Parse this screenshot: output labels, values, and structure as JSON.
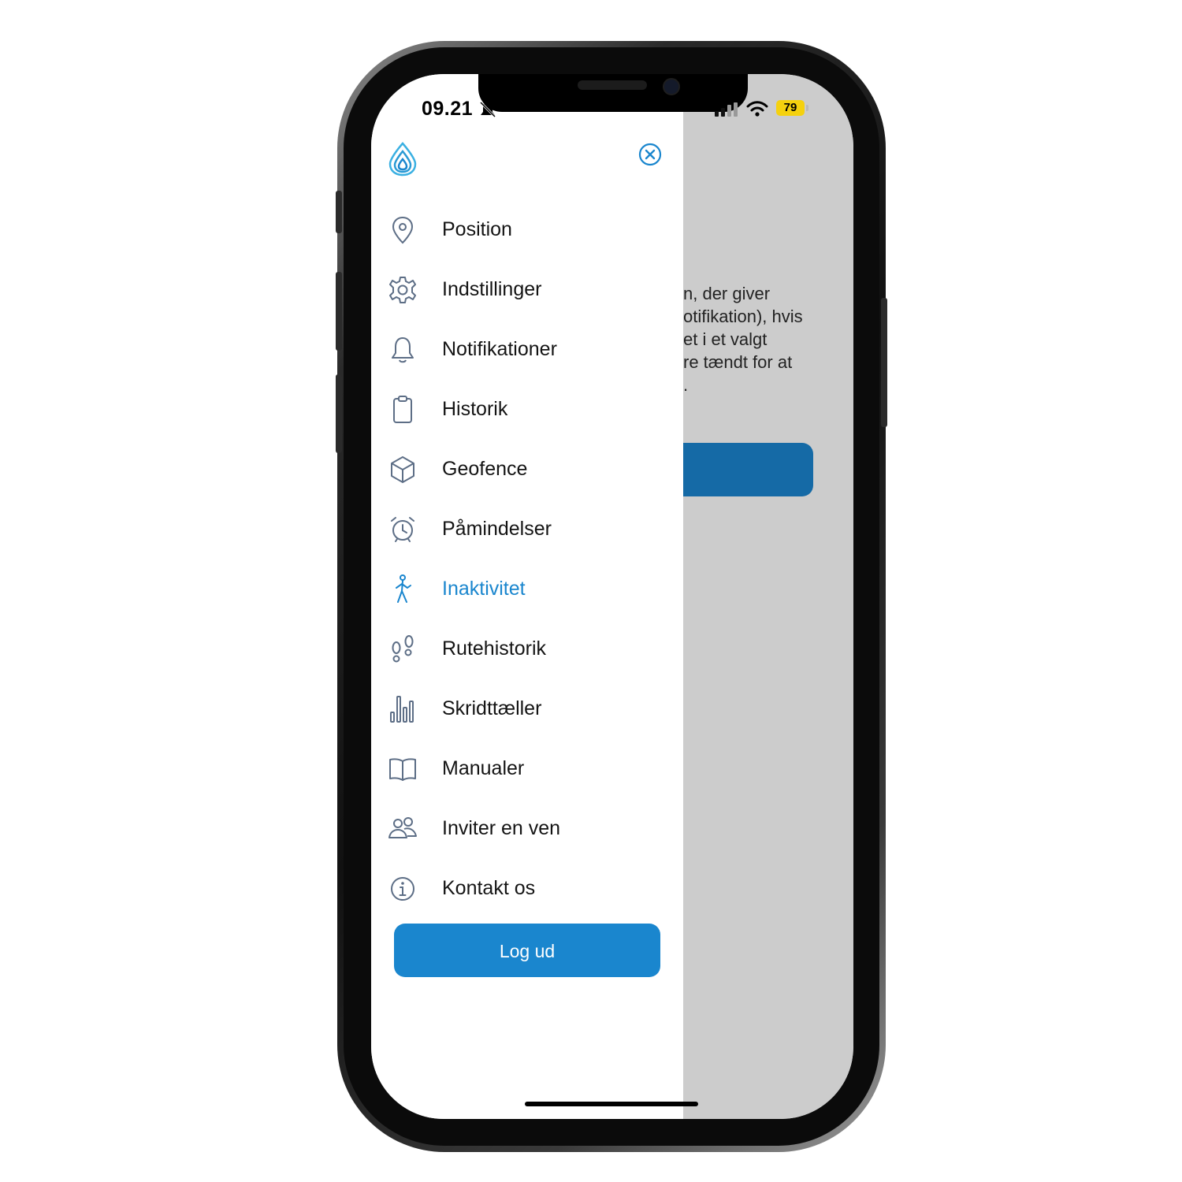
{
  "status_bar": {
    "time": "09.21",
    "battery": "79"
  },
  "background_text": [
    "n, der giver",
    "otifikation), hvis",
    "et i et valgt",
    "re tændt for at",
    "."
  ],
  "menu": {
    "items": [
      {
        "label": "Position",
        "icon": "location-pin-icon"
      },
      {
        "label": "Indstillinger",
        "icon": "gear-icon"
      },
      {
        "label": "Notifikationer",
        "icon": "bell-icon"
      },
      {
        "label": "Historik",
        "icon": "clipboard-icon"
      },
      {
        "label": "Geofence",
        "icon": "cube-icon"
      },
      {
        "label": "Påmindelser",
        "icon": "alarm-clock-icon"
      },
      {
        "label": "Inaktivitet",
        "icon": "walking-person-icon",
        "active": true
      },
      {
        "label": "Rutehistorik",
        "icon": "footprints-icon"
      },
      {
        "label": "Skridttæller",
        "icon": "bar-chart-icon"
      },
      {
        "label": "Manualer",
        "icon": "open-book-icon"
      },
      {
        "label": "Inviter en ven",
        "icon": "users-icon"
      },
      {
        "label": "Kontakt os",
        "icon": "info-icon"
      }
    ]
  },
  "logout_label": "Log ud",
  "colors": {
    "accent": "#1a86ce",
    "icon_gray": "#5d6e86",
    "dim_overlay": "#cccccc",
    "bg_button": "#156aa6"
  }
}
